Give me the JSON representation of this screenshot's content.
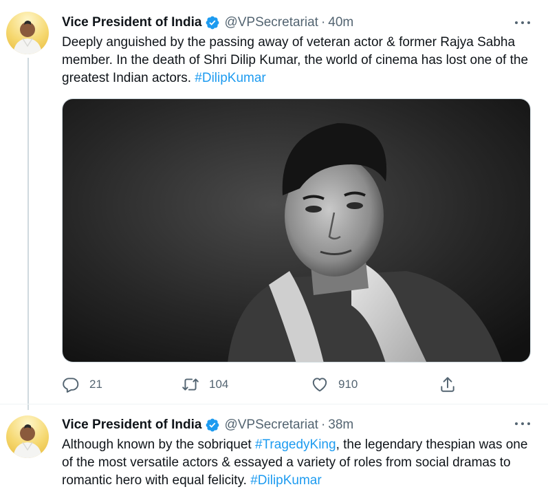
{
  "tweets": [
    {
      "author_name": "Vice President of India",
      "handle": "@VPSecretariat",
      "separator": "·",
      "time": "40m",
      "text_before": "Deeply anguished by the passing away of veteran actor & former Rajya Sabha member. In the death of Shri Dilip Kumar, the world of cinema has lost one of the greatest Indian actors. ",
      "hashtag": "#DilipKumar",
      "has_media": true,
      "media_description": "black-and-white portrait photo",
      "stats": {
        "replies": "21",
        "retweets": "104",
        "likes": "910"
      }
    },
    {
      "author_name": "Vice President of India",
      "handle": "@VPSecretariat",
      "separator": "·",
      "time": "38m",
      "text_part1": "Although known by the sobriquet ",
      "hashtag1": "#TragedyKing",
      "text_part2": ",  the legendary thespian was one of the most versatile actors & essayed a variety of roles from social dramas to romantic hero with equal felicity. ",
      "hashtag2": "#DilipKumar"
    }
  ],
  "colors": {
    "accent": "#1d9bf0",
    "text_primary": "#0f1419",
    "text_secondary": "#536471",
    "thread_line": "#cfd9de"
  },
  "icons": {
    "verified": "verified-badge-icon",
    "more": "more-dots-icon",
    "reply": "reply-icon",
    "retweet": "retweet-icon",
    "like": "heart-icon",
    "share": "share-icon"
  }
}
